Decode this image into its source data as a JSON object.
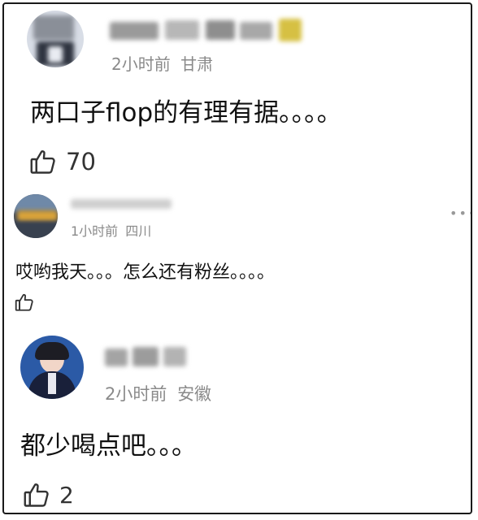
{
  "comments": [
    {
      "time": "2小时前",
      "location": "甘肃",
      "text": "两口子flop的有理有据。。。。",
      "likes": "70"
    },
    {
      "time": "1小时前",
      "location": "四川",
      "text": "哎哟我天。。。怎么还有粉丝。。。。",
      "likes": ""
    },
    {
      "time": "2小时前",
      "location": "安徽",
      "text": "都少喝点吧。。。",
      "likes": "2"
    }
  ],
  "icons": {
    "like": "thumbs-up-outline-icon",
    "more": "more-dots-icon"
  }
}
